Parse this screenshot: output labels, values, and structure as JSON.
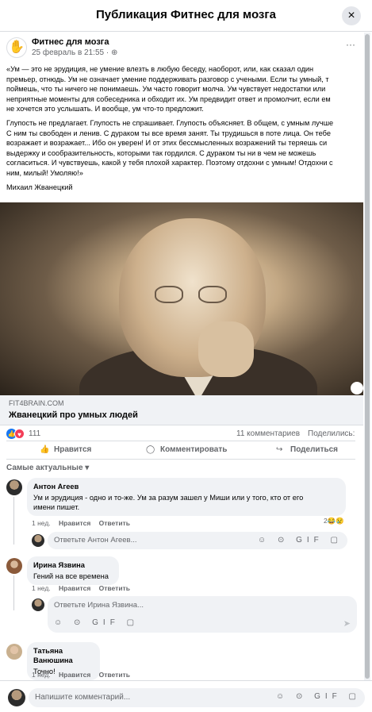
{
  "header": {
    "title": "Публикация Фитнес для мозга",
    "close_icon": "×"
  },
  "post": {
    "page_name": "Фитнес для мозга",
    "date": "25 февраль в 21:55 · ",
    "more_icon": "···",
    "text_lines": [
      "«Ум — это не эрудиция, не умение влезть в любую беседу, наоборот, или, как сказал один",
      "премьер, отнюдь. Ум не означает умение поддерживать разговор с учеными. Если ты умный, т",
      "поймешь, что ты ничего не понимаешь. Ум часто говорит молча. Ум чувствует недостатки или",
      "неприятные моменты для собеседника и обходит их. Ум предвидит ответ и промолчит, если ем",
      "не хочется это услышать. И вообще, ум что-то предложит."
    ],
    "text_lines_2": [
      "Глупость не предлагает. Глупость не спрашивает. Глупость объясняет. В общем, с умным лучше",
      "С ним ты свободен и ленив. С дураком ты все время занят. Ты трудишься в поте лица. Он тебе",
      "возражает и возражает... Ибо он уверен! И от этих бессмысленных возражений ты теряешь си",
      "выдержку и сообразительность, которыми так гордился. С дураком ты ни в чем не можешь",
      "согласиться. И чувствуешь, какой у тебя плохой характер. Поэтому отдохни с умным! Отдохни с",
      "ним, милый! Умоляю!»"
    ],
    "author": "Михаил Жванецкий",
    "link_domain": "FIT4BRAIN.COM",
    "link_title": "Жванецкий про умных людей",
    "reaction_count": "111",
    "comment_count": "11 комментариев",
    "share_label": "Поделились:",
    "actions": {
      "like": "Нравится",
      "comment": "Комментировать",
      "share": "Поделиться"
    },
    "sort_label": "Самые актуальные ▾"
  },
  "comments": [
    {
      "author": "Антон Агеев",
      "lines": [
        "Ум и эрудиция - одно и то-же. Ум за разум зашел у Миши или у того, кто от его",
        "имени пишет."
      ],
      "time": "1 нед.",
      "like": "Нравится",
      "reply": "Ответить",
      "reactions": "2😂😢",
      "reply_placeholder": "Ответьте Антон Агеев..."
    },
    {
      "author": "Ирина Язвина",
      "lines": [
        "Гений на все времена"
      ],
      "time": "1 нед.",
      "like": "Нравится",
      "reply": "Ответить",
      "reply_placeholder": "Ответьте Ирина Язвина..."
    },
    {
      "author": "Татьяна Ванюшина",
      "lines": [
        "Точно!"
      ],
      "time": "1 нед.",
      "like": "Нравится",
      "reply": "Ответить"
    }
  ],
  "composer": {
    "placeholder": "Напишите комментарий..."
  },
  "icons": {
    "input_icons": "☺ ⊙ GIF ▢",
    "reply_icons": "☺ ⊙ GIF ▢"
  },
  "colors": {
    "accent": "#1877f2",
    "love": "#f33e58",
    "muted": "#65676b",
    "bubble": "#f0f2f5"
  }
}
